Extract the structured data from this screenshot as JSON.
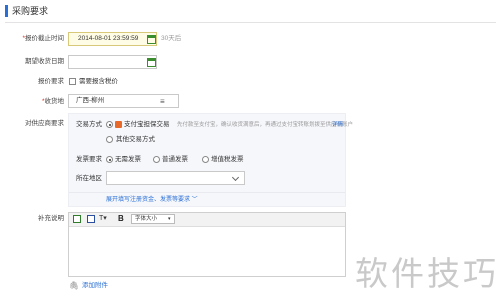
{
  "section": {
    "title": "采购要求"
  },
  "fields": {
    "deadline": {
      "label": "*报价截止时间",
      "value": "2014-08-01 23:59:59",
      "note": "30天后"
    },
    "delivery": {
      "label": "期望收货日期",
      "value": ""
    },
    "quote": {
      "label": "报价要求",
      "option": "需要报含税价"
    },
    "location": {
      "label": "*收货地",
      "value": "广西-柳州"
    },
    "supplier": {
      "label": "对供应商要求"
    },
    "remarks": {
      "label": "补充说明"
    }
  },
  "panel": {
    "trade_label": "交易方式",
    "trade_opt1": "支付宝担保交易",
    "trade_hint": "先付款至支付宝，确认收货满意后，再通过支付宝转账划拨至供应商账户",
    "trade_detail_link": "详情",
    "trade_opt2": "其他交易方式",
    "invoice_label": "发票要求",
    "invoice_opts": [
      "无需发票",
      "普通发票",
      "增值税发票"
    ],
    "region_label": "所在地区",
    "expand_link": "展开填写注册资金、发票等要求"
  },
  "editor": {
    "bold": "B",
    "font_size": "字体大小"
  },
  "attach": "添加附件",
  "watermark": "软件技巧",
  "colors": {
    "accent": "#2a6fd6",
    "required": "#e0261a",
    "calendar": "#3a8e2d"
  }
}
